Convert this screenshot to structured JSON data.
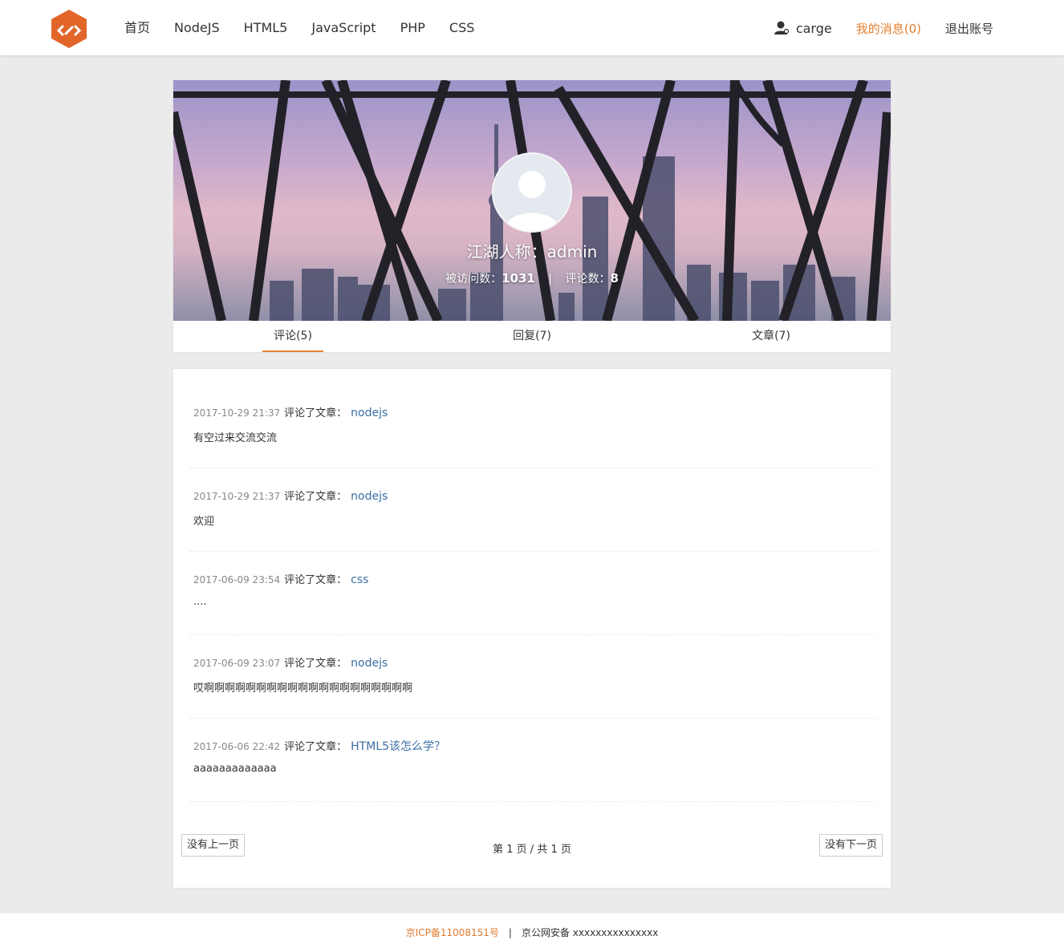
{
  "header": {
    "nav": [
      "首页",
      "NodeJS",
      "HTML5",
      "JavaScript",
      "PHP",
      "CSS"
    ],
    "username": "carge",
    "messages_label": "我的消息(0)",
    "logout_label": "退出账号"
  },
  "colors": {
    "accent": "#e7802f",
    "link": "#3a6ea5",
    "logo": "#e2662a"
  },
  "profile": {
    "nickname": "江湖人称：admin",
    "visits_label": "被访问数：",
    "visits": "1031",
    "comments_label": "评论数：",
    "comments": "8",
    "tabs": [
      "评论(5)",
      "回复(7)",
      "文章(7)"
    ],
    "active_tab": 0
  },
  "comments": [
    {
      "time": "2017-10-29 21:37",
      "action": "评论了文章：",
      "article": "nodejs",
      "content": "有空过来交流交流"
    },
    {
      "time": "2017-10-29 21:37",
      "action": "评论了文章：",
      "article": "nodejs",
      "content": "欢迎"
    },
    {
      "time": "2017-06-09 23:54",
      "action": "评论了文章：",
      "article": "css",
      "content": "...."
    },
    {
      "time": "2017-06-09 23:07",
      "action": "评论了文章：",
      "article": "nodejs",
      "content": "哎啊啊啊啊啊啊啊啊啊啊啊啊啊啊啊啊啊啊啊啊"
    },
    {
      "time": "2017-06-06 22:42",
      "action": "评论了文章：",
      "article": "HTML5该怎么学？",
      "content": "aaaaaaaaaaaaa"
    }
  ],
  "pager": {
    "prev": "没有上一页",
    "info": "第 1 页 / 共 1 页",
    "next": "没有下一页"
  },
  "footer": {
    "icp": "京ICP备11008151号",
    "sep": "|",
    "police": "京公网安备 xxxxxxxxxxxxxxx"
  }
}
